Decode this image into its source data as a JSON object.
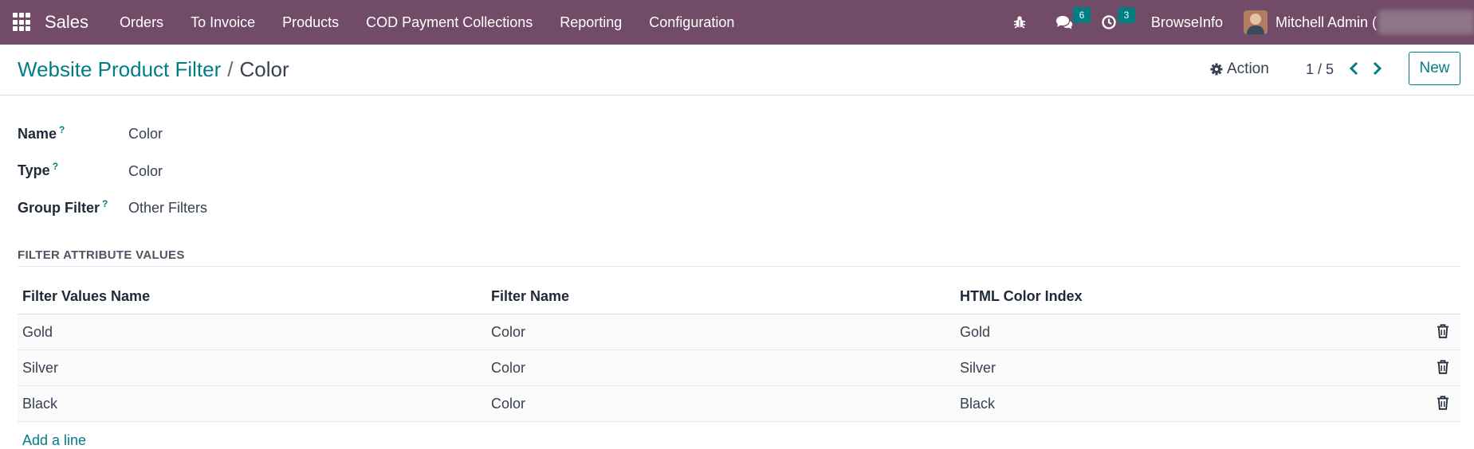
{
  "navbar": {
    "app_name": "Sales",
    "menu": [
      "Orders",
      "To Invoice",
      "Products",
      "COD Payment Collections",
      "Reporting",
      "Configuration"
    ],
    "messages_count": "6",
    "activities_count": "3",
    "company": "BrowseInfo",
    "user_name": "Mitchell Admin ("
  },
  "control": {
    "breadcrumb_parent": "Website Product Filter",
    "breadcrumb_sep": "/",
    "breadcrumb_current": "Color",
    "action_label": "Action",
    "pager": "1 / 5",
    "new_label": "New"
  },
  "form": {
    "name_label": "Name",
    "name_value": "Color",
    "type_label": "Type",
    "type_value": "Color",
    "group_label": "Group Filter",
    "group_value": "Other Filters",
    "help_mark": "?"
  },
  "section": {
    "title": "FILTER ATTRIBUTE VALUES",
    "columns": [
      "Filter Values Name",
      "Filter Name",
      "HTML Color Index"
    ],
    "rows": [
      [
        "Gold",
        "Color",
        "Gold"
      ],
      [
        "Silver",
        "Color",
        "Silver"
      ],
      [
        "Black",
        "Color",
        "Black"
      ]
    ],
    "add_line": "Add a line"
  },
  "colors": {
    "navbar_bg": "#714b67",
    "accent": "#017e84"
  },
  "icons": [
    "apps-grid-icon",
    "bug-icon",
    "chat-icon",
    "clock-icon",
    "gear-icon",
    "chevron-left-icon",
    "chevron-right-icon",
    "trash-icon"
  ]
}
